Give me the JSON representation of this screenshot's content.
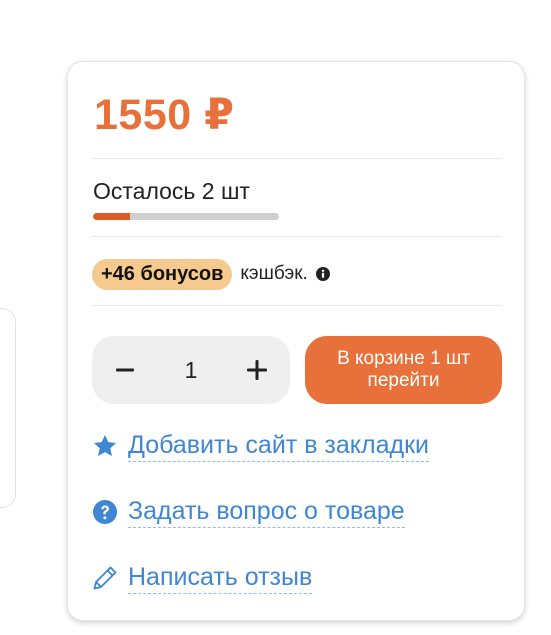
{
  "product": {
    "price": "1550 ₽",
    "stock_label": "Осталось 2 шт",
    "stock_level": 0.2,
    "bonus_badge": "+46 бонусов",
    "bonus_text": "кэшбэк.",
    "quantity": "1",
    "cart_line1": "В корзине 1 шт",
    "cart_line2": "перейти"
  },
  "links": {
    "bookmark": "Добавить сайт в закладки",
    "question": "Задать вопрос о товаре",
    "review": "Написать отзыв"
  },
  "icons": {
    "bookmark": "star-icon",
    "question": "question-circle-icon",
    "review": "pencil-icon",
    "info": "info-icon",
    "decrease": "minus-icon",
    "increase": "plus-icon"
  },
  "colors": {
    "accent": "#e8703a",
    "stock_fill": "#e05a24",
    "bonus_badge_bg": "#f6c98f",
    "link": "#3f86d3",
    "stepper_bg": "#efeff0"
  }
}
